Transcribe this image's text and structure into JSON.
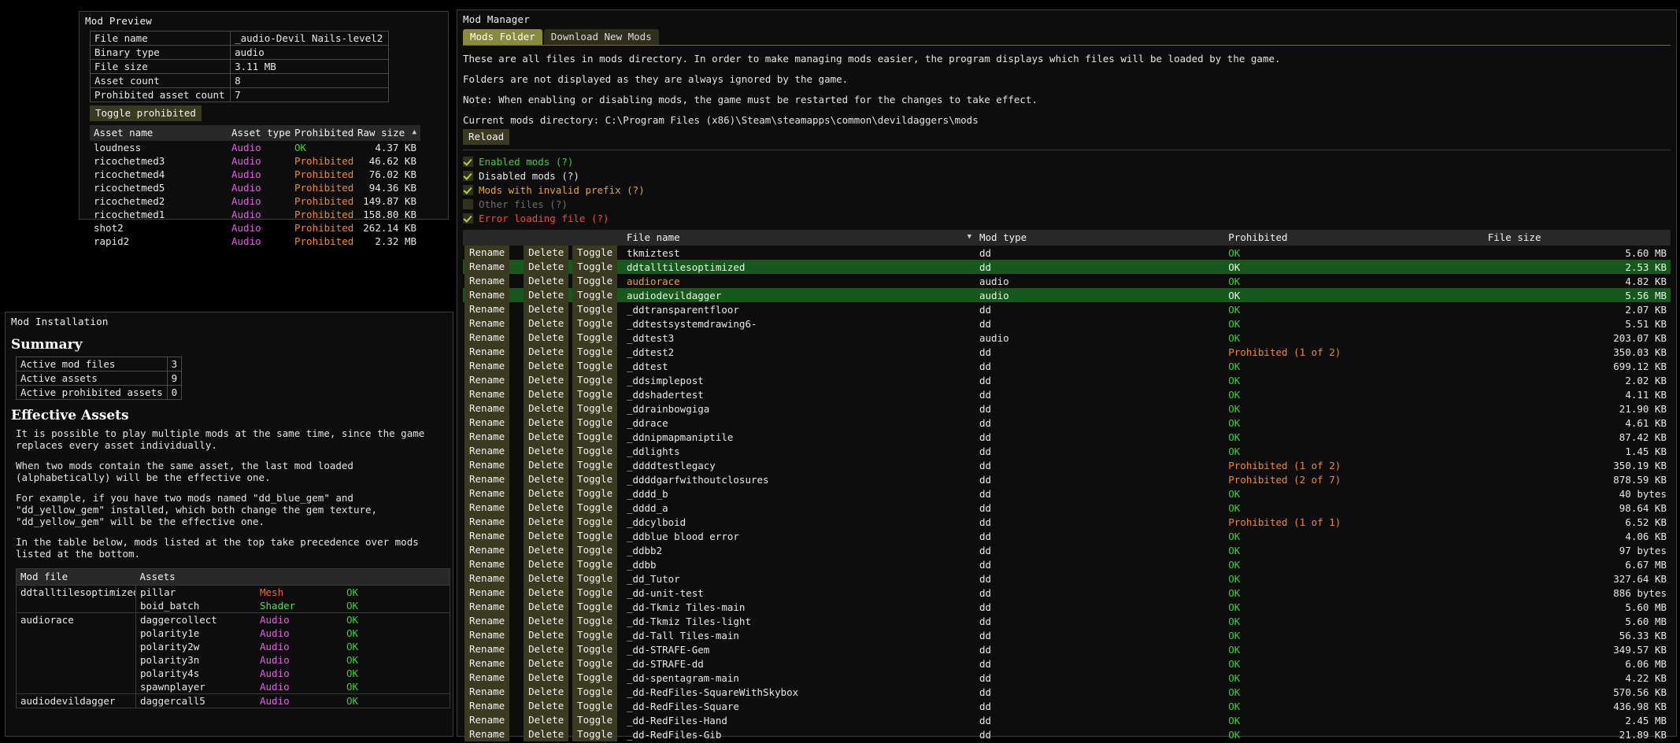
{
  "mod_preview": {
    "title": "Mod Preview",
    "info_rows": [
      {
        "label": "File name",
        "value": "_audio-Devil Nails-level2"
      },
      {
        "label": "Binary type",
        "value": "audio"
      },
      {
        "label": "File size",
        "value": "3.11 MB"
      },
      {
        "label": "Asset count",
        "value": "8"
      },
      {
        "label": "Prohibited asset count",
        "value": "7"
      }
    ],
    "toggle_button": "Toggle prohibited",
    "columns": [
      "Asset name",
      "Asset type",
      "Prohibited",
      "Raw size"
    ],
    "sort_column": "Raw size",
    "sort_arrow": "▲",
    "rows": [
      {
        "name": "loudness",
        "type": "Audio",
        "type_class": "c-audio",
        "prohibited": "OK",
        "proh_class": "c-ok",
        "size": "4.37 KB"
      },
      {
        "name": "ricochetmed3",
        "type": "Audio",
        "type_class": "c-audio",
        "prohibited": "Prohibited",
        "proh_class": "c-proh",
        "size": "46.62 KB"
      },
      {
        "name": "ricochetmed4",
        "type": "Audio",
        "type_class": "c-audio",
        "prohibited": "Prohibited",
        "proh_class": "c-proh",
        "size": "76.02 KB"
      },
      {
        "name": "ricochetmed5",
        "type": "Audio",
        "type_class": "c-audio",
        "prohibited": "Prohibited",
        "proh_class": "c-proh",
        "size": "94.36 KB"
      },
      {
        "name": "ricochetmed2",
        "type": "Audio",
        "type_class": "c-audio",
        "prohibited": "Prohibited",
        "proh_class": "c-proh",
        "size": "149.87 KB"
      },
      {
        "name": "ricochetmed1",
        "type": "Audio",
        "type_class": "c-audio",
        "prohibited": "Prohibited",
        "proh_class": "c-proh",
        "size": "158.80 KB"
      },
      {
        "name": "shot2",
        "type": "Audio",
        "type_class": "c-audio",
        "prohibited": "Prohibited",
        "proh_class": "c-proh",
        "size": "262.14 KB"
      },
      {
        "name": "rapid2",
        "type": "Audio",
        "type_class": "c-audio",
        "prohibited": "Prohibited",
        "proh_class": "c-proh",
        "size": "2.32 MB"
      }
    ]
  },
  "mod_installation": {
    "title": "Mod Installation",
    "summary_heading": "Summary",
    "summary_rows": [
      {
        "label": "Active mod files",
        "value": "3"
      },
      {
        "label": "Active assets",
        "value": "9"
      },
      {
        "label": "Active prohibited assets",
        "value": "0"
      }
    ],
    "effective_heading": "Effective Assets",
    "paragraphs": [
      "It is possible to play multiple mods at the same time, since the game replaces every asset individually.",
      "When two mods contain the same asset, the last mod loaded (alphabetically) will be the effective one.",
      "For example, if you have two mods named \"dd_blue_gem\" and \"dd_yellow_gem\" installed, which both change the gem texture, \"dd_yellow_gem\" will be the effective one.",
      "In the table below, mods listed at the top take precedence over mods listed at the bottom."
    ],
    "columns": [
      "Mod file",
      "Assets"
    ],
    "groups": [
      {
        "mod_file": "ddtalltilesoptimized",
        "assets": [
          {
            "name": "pillar",
            "type": "Mesh",
            "type_class": "c-mesh",
            "status": "OK"
          },
          {
            "name": "boid_batch",
            "type": "Shader",
            "type_class": "c-shader",
            "status": "OK"
          }
        ]
      },
      {
        "mod_file": "audiorace",
        "assets": [
          {
            "name": "daggercollect",
            "type": "Audio",
            "type_class": "c-audio",
            "status": "OK"
          },
          {
            "name": "polarity1e",
            "type": "Audio",
            "type_class": "c-audio",
            "status": "OK"
          },
          {
            "name": "polarity2w",
            "type": "Audio",
            "type_class": "c-audio",
            "status": "OK"
          },
          {
            "name": "polarity3n",
            "type": "Audio",
            "type_class": "c-audio",
            "status": "OK"
          },
          {
            "name": "polarity4s",
            "type": "Audio",
            "type_class": "c-audio",
            "status": "OK"
          },
          {
            "name": "spawnplayer",
            "type": "Audio",
            "type_class": "c-audio",
            "status": "OK"
          }
        ]
      },
      {
        "mod_file": "audiodevildagger",
        "assets": [
          {
            "name": "daggercall5",
            "type": "Audio",
            "type_class": "c-audio",
            "status": "OK"
          }
        ]
      }
    ]
  },
  "mod_manager": {
    "title": "Mod Manager",
    "tabs": [
      {
        "label": "Mods Folder",
        "active": true
      },
      {
        "label": "Download New Mods",
        "active": false
      }
    ],
    "paragraphs": [
      "These are all files in mods directory. In order to make managing mods easier, the program displays which files will be loaded by the game.",
      "Folders are not displayed as they are always ignored by the game.",
      "Note: When enabling or disabling mods, the game must be restarted for the changes to take effect."
    ],
    "current_dir_label": "Current mods directory: C:\\Program Files (x86)\\Steam\\steamapps\\common\\devildaggers\\mods",
    "reload_button": "Reload",
    "filters": [
      {
        "label": "Enabled mods (?)",
        "checked": true,
        "class": "c-green"
      },
      {
        "label": "Disabled mods (?)",
        "checked": true,
        "class": "c-white"
      },
      {
        "label": "Mods with invalid prefix (?)",
        "checked": true,
        "class": "c-orange"
      },
      {
        "label": "Other files (?)",
        "checked": false,
        "class": "c-gray"
      },
      {
        "label": "Error loading file (?)",
        "checked": true,
        "class": "c-red"
      }
    ],
    "row_actions": [
      "Rename",
      "Delete",
      "Toggle"
    ],
    "columns": [
      "File name",
      "Mod type",
      "Prohibited",
      "File size"
    ],
    "sort_column": "File name",
    "sort_arrow": "▼",
    "rows": [
      {
        "name": "tkmiztest",
        "name_class": "c-white",
        "type": "dd",
        "prohibited": "OK",
        "proh_class": "c-ok",
        "size": "5.60 MB",
        "highlight": false
      },
      {
        "name": "ddtalltilesoptimized",
        "name_class": "c-white",
        "type": "dd",
        "prohibited": "OK",
        "proh_class": "c-ok",
        "size": "2.53 KB",
        "highlight": true
      },
      {
        "name": "audiorace",
        "name_class": "c-orange",
        "type": "audio",
        "prohibited": "OK",
        "proh_class": "c-ok",
        "size": "4.82 KB",
        "highlight": false
      },
      {
        "name": "audiodevildagger",
        "name_class": "c-orange",
        "type": "audio",
        "prohibited": "OK",
        "proh_class": "c-ok",
        "size": "5.56 MB",
        "highlight": true
      },
      {
        "name": "_ddtransparentfloor",
        "name_class": "c-white",
        "type": "dd",
        "prohibited": "OK",
        "proh_class": "c-ok",
        "size": "2.07 KB",
        "highlight": false
      },
      {
        "name": "_ddtestsystemdrawing6-",
        "name_class": "c-white",
        "type": "dd",
        "prohibited": "OK",
        "proh_class": "c-ok",
        "size": "5.51 KB",
        "highlight": false
      },
      {
        "name": "_ddtest3",
        "name_class": "c-white",
        "type": "audio",
        "prohibited": "OK",
        "proh_class": "c-ok",
        "size": "203.07 KB",
        "highlight": false
      },
      {
        "name": "_ddtest2",
        "name_class": "c-white",
        "type": "dd",
        "prohibited": "Prohibited (1 of 2)",
        "proh_class": "c-proh",
        "size": "350.03 KB",
        "highlight": false
      },
      {
        "name": "_ddtest",
        "name_class": "c-white",
        "type": "dd",
        "prohibited": "OK",
        "proh_class": "c-ok",
        "size": "699.12 KB",
        "highlight": false
      },
      {
        "name": "_ddsimplepost",
        "name_class": "c-white",
        "type": "dd",
        "prohibited": "OK",
        "proh_class": "c-ok",
        "size": "2.02 KB",
        "highlight": false
      },
      {
        "name": "_ddshadertest",
        "name_class": "c-white",
        "type": "dd",
        "prohibited": "OK",
        "proh_class": "c-ok",
        "size": "4.11 KB",
        "highlight": false
      },
      {
        "name": "_ddrainbowgiga",
        "name_class": "c-white",
        "type": "dd",
        "prohibited": "OK",
        "proh_class": "c-ok",
        "size": "21.90 KB",
        "highlight": false
      },
      {
        "name": "_ddrace",
        "name_class": "c-white",
        "type": "dd",
        "prohibited": "OK",
        "proh_class": "c-ok",
        "size": "4.61 KB",
        "highlight": false
      },
      {
        "name": "_ddnipmapmaniptile",
        "name_class": "c-white",
        "type": "dd",
        "prohibited": "OK",
        "proh_class": "c-ok",
        "size": "87.42 KB",
        "highlight": false
      },
      {
        "name": "_ddlights",
        "name_class": "c-white",
        "type": "dd",
        "prohibited": "OK",
        "proh_class": "c-ok",
        "size": "1.45 KB",
        "highlight": false
      },
      {
        "name": "_ddddtestlegacy",
        "name_class": "c-white",
        "type": "dd",
        "prohibited": "Prohibited (1 of 2)",
        "proh_class": "c-proh",
        "size": "350.19 KB",
        "highlight": false
      },
      {
        "name": "_ddddgarfwithoutclosures",
        "name_class": "c-white",
        "type": "dd",
        "prohibited": "Prohibited (2 of 7)",
        "proh_class": "c-proh",
        "size": "878.59 KB",
        "highlight": false
      },
      {
        "name": "_dddd_b",
        "name_class": "c-white",
        "type": "dd",
        "prohibited": "OK",
        "proh_class": "c-ok",
        "size": "40 bytes",
        "highlight": false
      },
      {
        "name": "_dddd_a",
        "name_class": "c-white",
        "type": "dd",
        "prohibited": "OK",
        "proh_class": "c-ok",
        "size": "98.64 KB",
        "highlight": false
      },
      {
        "name": "_ddcylboid",
        "name_class": "c-white",
        "type": "dd",
        "prohibited": "Prohibited (1 of 1)",
        "proh_class": "c-proh",
        "size": "6.52 KB",
        "highlight": false
      },
      {
        "name": "_ddblue blood error",
        "name_class": "c-white",
        "type": "dd",
        "prohibited": "OK",
        "proh_class": "c-ok",
        "size": "4.06 KB",
        "highlight": false
      },
      {
        "name": "_ddbb2",
        "name_class": "c-white",
        "type": "dd",
        "prohibited": "OK",
        "proh_class": "c-ok",
        "size": "97 bytes",
        "highlight": false
      },
      {
        "name": "_ddbb",
        "name_class": "c-white",
        "type": "dd",
        "prohibited": "OK",
        "proh_class": "c-ok",
        "size": "6.67 MB",
        "highlight": false
      },
      {
        "name": "_dd_Tutor",
        "name_class": "c-white",
        "type": "dd",
        "prohibited": "OK",
        "proh_class": "c-ok",
        "size": "327.64 KB",
        "highlight": false
      },
      {
        "name": "_dd-unit-test",
        "name_class": "c-white",
        "type": "dd",
        "prohibited": "OK",
        "proh_class": "c-ok",
        "size": "886 bytes",
        "highlight": false
      },
      {
        "name": "_dd-Tkmiz Tiles-main",
        "name_class": "c-white",
        "type": "dd",
        "prohibited": "OK",
        "proh_class": "c-ok",
        "size": "5.60 MB",
        "highlight": false
      },
      {
        "name": "_dd-Tkmiz Tiles-light",
        "name_class": "c-white",
        "type": "dd",
        "prohibited": "OK",
        "proh_class": "c-ok",
        "size": "5.60 MB",
        "highlight": false
      },
      {
        "name": "_dd-Tall Tiles-main",
        "name_class": "c-white",
        "type": "dd",
        "prohibited": "OK",
        "proh_class": "c-ok",
        "size": "56.33 KB",
        "highlight": false
      },
      {
        "name": "_dd-STRAFE-Gem",
        "name_class": "c-white",
        "type": "dd",
        "prohibited": "OK",
        "proh_class": "c-ok",
        "size": "349.57 KB",
        "highlight": false
      },
      {
        "name": "_dd-STRAFE-dd",
        "name_class": "c-white",
        "type": "dd",
        "prohibited": "OK",
        "proh_class": "c-ok",
        "size": "6.06 MB",
        "highlight": false
      },
      {
        "name": "_dd-spentagram-main",
        "name_class": "c-white",
        "type": "dd",
        "prohibited": "OK",
        "proh_class": "c-ok",
        "size": "4.22 KB",
        "highlight": false
      },
      {
        "name": "_dd-RedFiles-SquareWithSkybox",
        "name_class": "c-white",
        "type": "dd",
        "prohibited": "OK",
        "proh_class": "c-ok",
        "size": "570.56 KB",
        "highlight": false
      },
      {
        "name": "_dd-RedFiles-Square",
        "name_class": "c-white",
        "type": "dd",
        "prohibited": "OK",
        "proh_class": "c-ok",
        "size": "436.98 KB",
        "highlight": false
      },
      {
        "name": "_dd-RedFiles-Hand",
        "name_class": "c-white",
        "type": "dd",
        "prohibited": "OK",
        "proh_class": "c-ok",
        "size": "2.45 MB",
        "highlight": false
      },
      {
        "name": "_dd-RedFiles-Gib",
        "name_class": "c-white",
        "type": "dd",
        "prohibited": "OK",
        "proh_class": "c-ok",
        "size": "21.89 KB",
        "highlight": false
      }
    ]
  }
}
